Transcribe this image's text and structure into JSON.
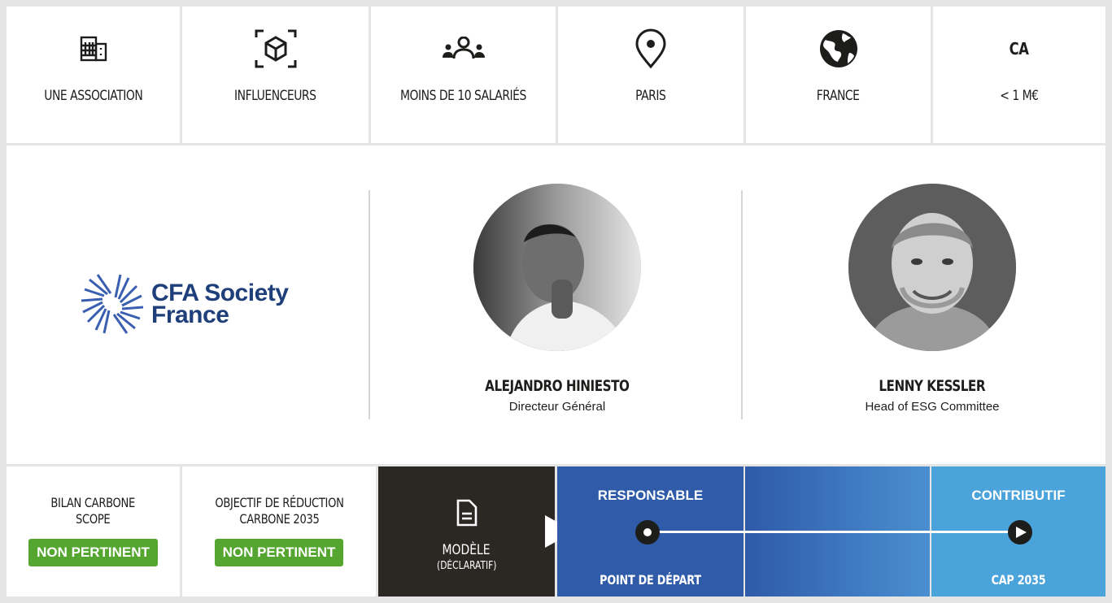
{
  "info_bar": {
    "items": [
      {
        "icon": "building-icon",
        "label": "UNE ASSOCIATION"
      },
      {
        "icon": "cube-scan-icon",
        "label": "INFLUENCEURS"
      },
      {
        "icon": "people-group-icon",
        "label": "MOINS DE 10 SALARIÉS"
      },
      {
        "icon": "map-pin-icon",
        "label": "PARIS"
      },
      {
        "icon": "globe-icon",
        "label": "FRANCE"
      }
    ],
    "revenue": {
      "title": "CA",
      "value": "< 1 M€"
    }
  },
  "organization": {
    "logo_line1": "CFA Society",
    "logo_line2": "France",
    "logo_color": "#1f3f7a"
  },
  "people": [
    {
      "name": "ALEJANDRO HINIESTO",
      "role": "Directeur Général",
      "avatar": "portrait-photo"
    },
    {
      "name": "LENNY KESSLER",
      "role": "Head of ESG Committee",
      "avatar": "portrait-photo"
    }
  ],
  "metrics": [
    {
      "title_line1": "BILAN CARBONE",
      "title_line2": "SCOPE",
      "badge": "NON PERTINENT"
    },
    {
      "title_line1": "OBJECTIF DE RÉDUCTION",
      "title_line2": "CARBONE  2035",
      "badge": "NON PERTINENT"
    }
  ],
  "model": {
    "label": "MODÈLE",
    "sublabel": "(DÉCLARATIF)",
    "icon": "document-icon"
  },
  "trajectory": {
    "start_title": "RESPONSABLE",
    "start_footer": "POINT DE DÉPART",
    "end_title": "CONTRIBUTIF",
    "end_footer": "CAP 2035"
  },
  "colors": {
    "badge_green": "#55a630",
    "model_dark": "#2b2723",
    "track_dark_blue": "#2f5ba8",
    "track_light_blue": "#4aa3da"
  }
}
